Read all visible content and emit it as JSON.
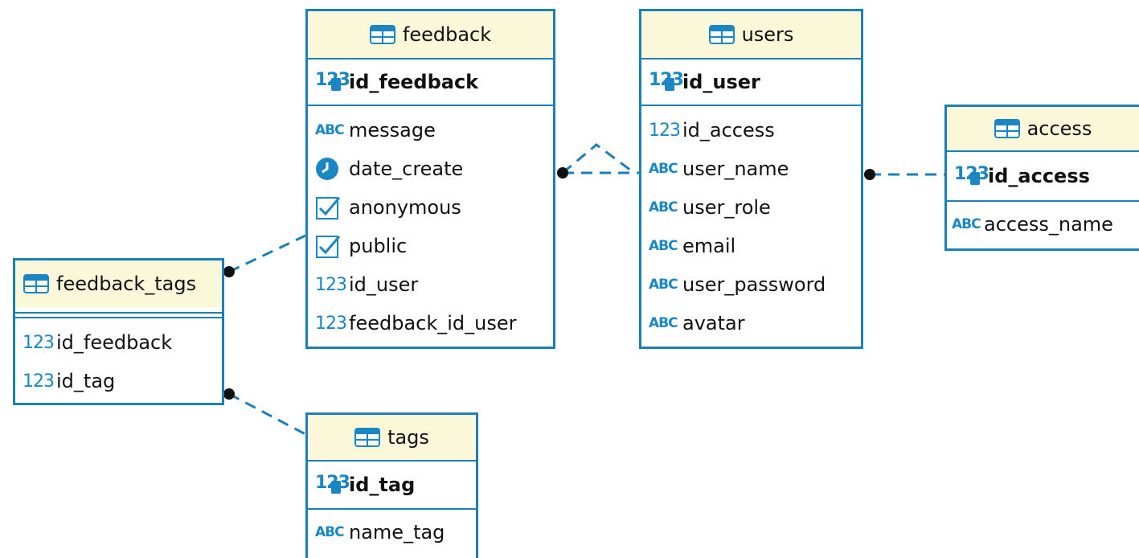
{
  "tables": {
    "feedback": {
      "name": "feedback",
      "pk": "id_feedback",
      "columns": [
        {
          "name": "message",
          "type": "abc"
        },
        {
          "name": "date_create",
          "type": "clock"
        },
        {
          "name": "anonymous",
          "type": "check"
        },
        {
          "name": "public",
          "type": "check"
        },
        {
          "name": "id_user",
          "type": "num"
        },
        {
          "name": "feedback_id_user",
          "type": "num"
        }
      ]
    },
    "users": {
      "name": "users",
      "pk": "id_user",
      "columns": [
        {
          "name": "id_access",
          "type": "num"
        },
        {
          "name": "user_name",
          "type": "abc"
        },
        {
          "name": "user_role",
          "type": "abc"
        },
        {
          "name": "email",
          "type": "abc"
        },
        {
          "name": "user_password",
          "type": "abc"
        },
        {
          "name": "avatar",
          "type": "abc"
        }
      ]
    },
    "access": {
      "name": "access",
      "pk": "id_access",
      "columns": [
        {
          "name": "access_name",
          "type": "abc"
        }
      ]
    },
    "feedback_tags": {
      "name": "feedback_tags",
      "columns": [
        {
          "name": "id_feedback",
          "type": "num"
        },
        {
          "name": "id_tag",
          "type": "num"
        }
      ]
    },
    "tags": {
      "name": "tags",
      "pk": "id_tag",
      "columns": [
        {
          "name": "name_tag",
          "type": "abc"
        }
      ]
    }
  },
  "type_icons": {
    "num": "123",
    "abc": "ABC",
    "pk": "123"
  },
  "colors": {
    "border": "#1b7fb8",
    "header_bg": "#fbf8d9",
    "icon": "#1b86c4",
    "link": "#1b7fb8"
  }
}
